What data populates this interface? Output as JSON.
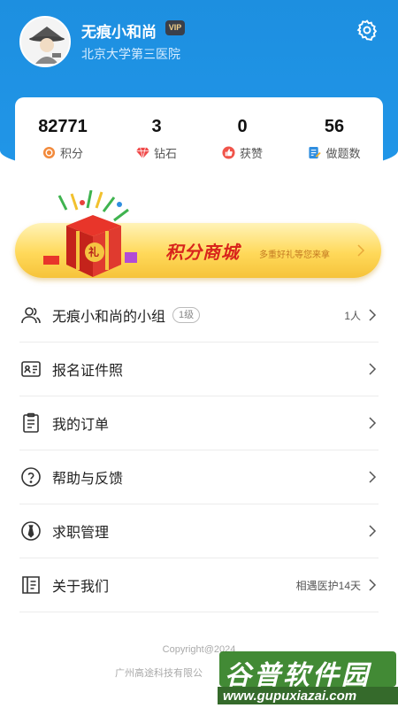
{
  "profile": {
    "username": "无痕小和尚",
    "vip_label": "VIP",
    "hospital": "北京大学第三医院"
  },
  "stats": [
    {
      "value": "82771",
      "label": "积分",
      "icon": "points-icon",
      "color": "#f28a3c"
    },
    {
      "value": "3",
      "label": "钻石",
      "icon": "diamond-icon",
      "color": "#f04a4a"
    },
    {
      "value": "0",
      "label": "获赞",
      "icon": "like-icon",
      "color": "#f0544a"
    },
    {
      "value": "56",
      "label": "做题数",
      "icon": "exercise-icon",
      "color": "#2f8ee0"
    }
  ],
  "mall": {
    "title": "积分商城",
    "subtitle": "多重好礼等您来拿",
    "gift_char": "礼"
  },
  "menu": [
    {
      "label": "无痕小和尚的小组",
      "badge": "1级",
      "right": "1人",
      "icon": "group-icon"
    },
    {
      "label": "报名证件照",
      "right": "",
      "icon": "id-card-icon"
    },
    {
      "label": "我的订单",
      "right": "",
      "icon": "order-icon"
    },
    {
      "label": "帮助与反馈",
      "right": "",
      "icon": "help-icon"
    },
    {
      "label": "求职管理",
      "right": "",
      "icon": "job-icon"
    },
    {
      "label": "关于我们",
      "right": "相遇医护14天",
      "icon": "about-icon"
    }
  ],
  "footer": {
    "copyright": "Copyright@2024",
    "company": "广州高途科技有限公"
  },
  "watermark": {
    "title": "谷普软件园",
    "url": "www.gupuxiazai.com"
  },
  "colors": {
    "header": "#2196e8",
    "mall_title": "#d8241c"
  }
}
